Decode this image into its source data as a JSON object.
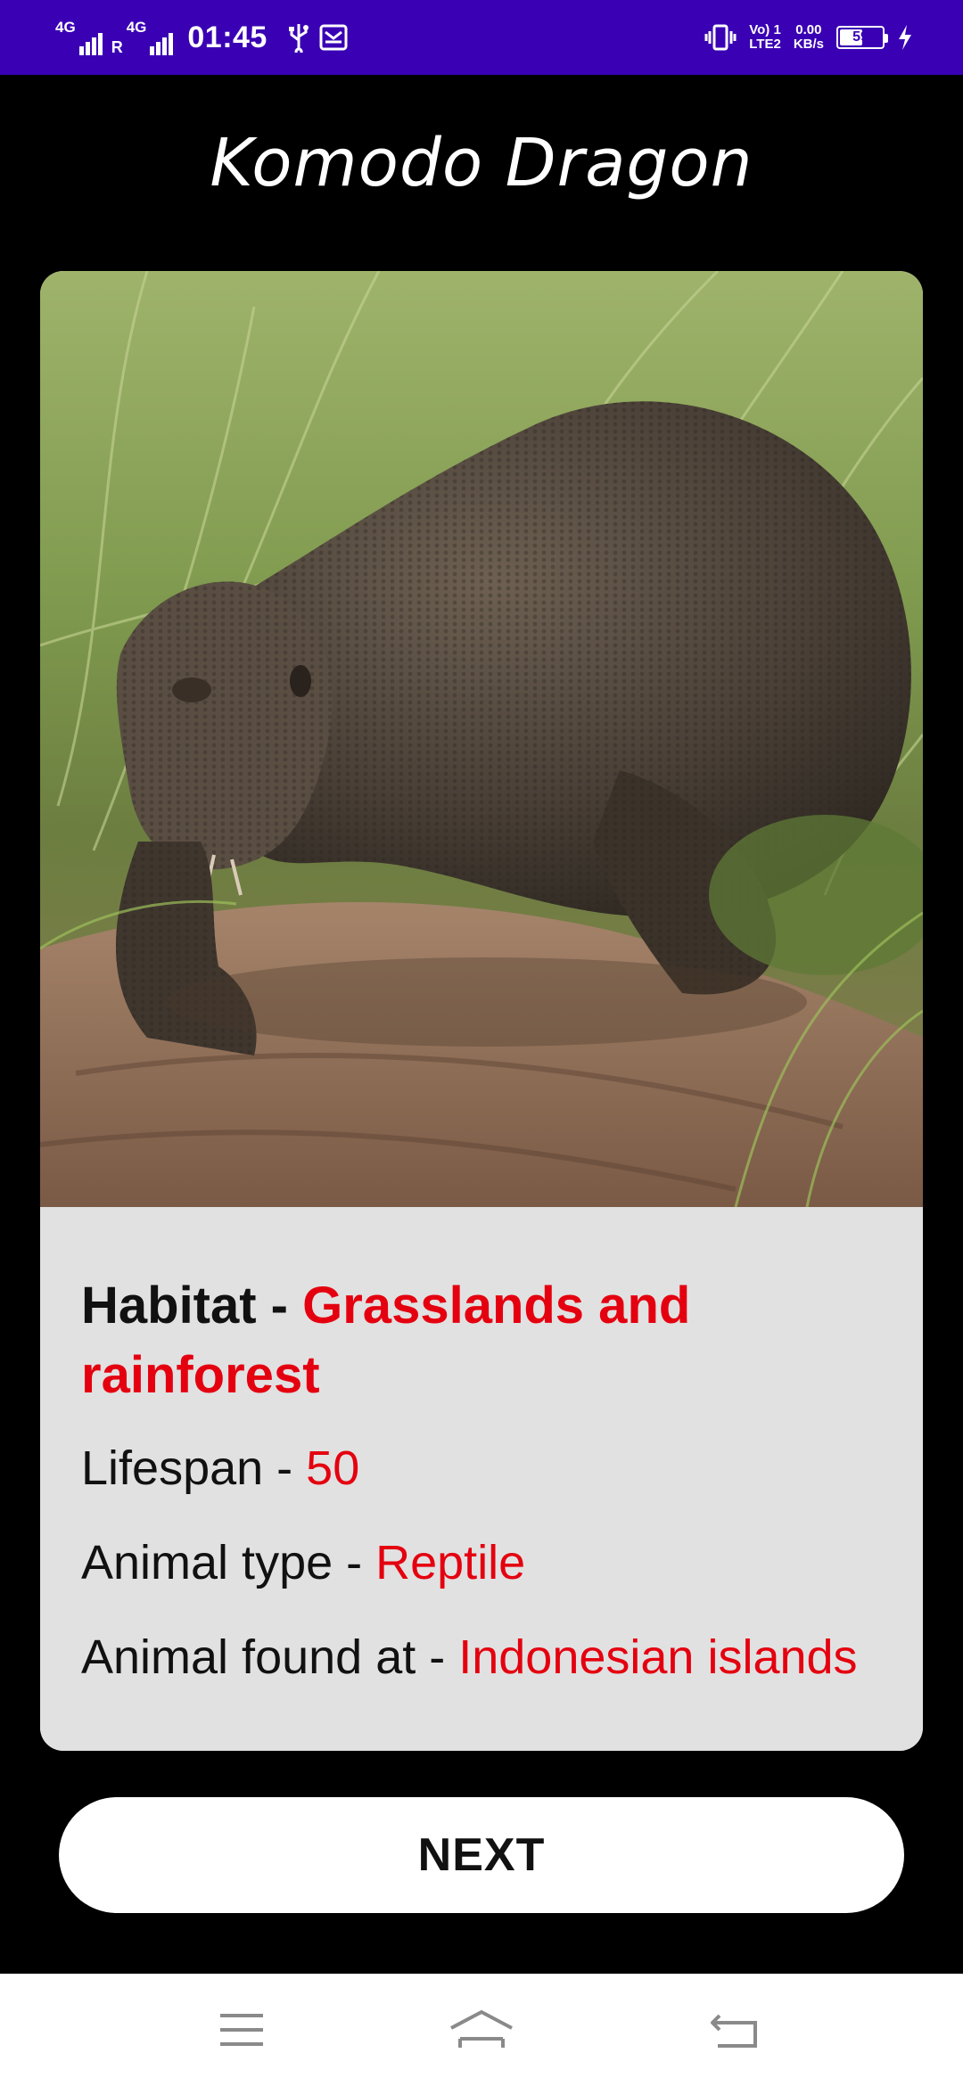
{
  "status_bar": {
    "sim1_label": "4G",
    "sim2_label": "4G",
    "roaming": "R",
    "time": "01:45",
    "lte_top": "Vo) 1",
    "lte_bottom": "LTE2",
    "speed_value": "0.00",
    "speed_unit": "KB/s",
    "battery_level": "59",
    "background_color": "#3a00b4"
  },
  "page": {
    "title": "Komodo Dragon"
  },
  "card": {
    "habitat_label": "Habitat - ",
    "habitat_value": "Grasslands and rainforest",
    "lifespan_label": "Lifespan - ",
    "lifespan_value": "50",
    "type_label": "Animal type - ",
    "type_value": "Reptile",
    "found_label": "Animal found at - ",
    "found_value": "Indonesian islands",
    "value_color": "#e4000f"
  },
  "actions": {
    "next_label": "NEXT"
  },
  "nav_bar": {
    "icons": [
      "menu-icon",
      "home-icon",
      "back-icon"
    ]
  }
}
